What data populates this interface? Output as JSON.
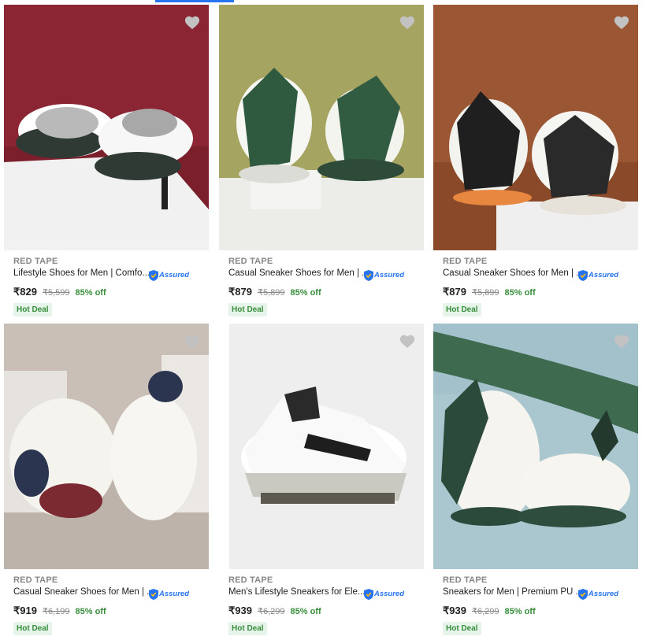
{
  "colors": {
    "accent": "#2874f0",
    "offer_green": "#388e3c",
    "deal_bg": "#e6f4ea",
    "heart": "#c2c2c2"
  },
  "products": [
    {
      "brand": "RED TAPE",
      "title": "Lifestyle Shoes for Men | Comfo...",
      "assured": "Assured",
      "price": "₹829",
      "mrp": "₹5,599",
      "discount": "85% off",
      "badge": "Hot Deal",
      "icon": "heart-icon"
    },
    {
      "brand": "RED TAPE",
      "title": "Casual Sneaker Shoes for Men | ...",
      "assured": "Assured",
      "price": "₹879",
      "mrp": "₹5,899",
      "discount": "85% off",
      "badge": "Hot Deal",
      "icon": "heart-icon"
    },
    {
      "brand": "RED TAPE",
      "title": "Casual Sneaker Shoes for Men | ...",
      "assured": "Assured",
      "price": "₹879",
      "mrp": "₹5,899",
      "discount": "85% off",
      "badge": "Hot Deal",
      "icon": "heart-icon"
    },
    {
      "brand": "RED TAPE",
      "title": "Casual Sneaker Shoes for Men | ...",
      "assured": "Assured",
      "price": "₹919",
      "mrp": "₹6,199",
      "discount": "85% off",
      "badge": "Hot Deal",
      "icon": "heart-icon"
    },
    {
      "brand": "RED TAPE",
      "title": "Men's Lifestyle Sneakers for Ele...",
      "assured": "Assured",
      "price": "₹939",
      "mrp": "₹6,299",
      "discount": "85% off",
      "badge": "Hot Deal",
      "icon": "heart-icon"
    },
    {
      "brand": "RED TAPE",
      "title": "Sneakers for Men | Premium PU ...",
      "assured": "Assured",
      "price": "₹939",
      "mrp": "₹6,299",
      "discount": "85% off",
      "badge": "Hot Deal",
      "icon": "heart-icon"
    }
  ]
}
